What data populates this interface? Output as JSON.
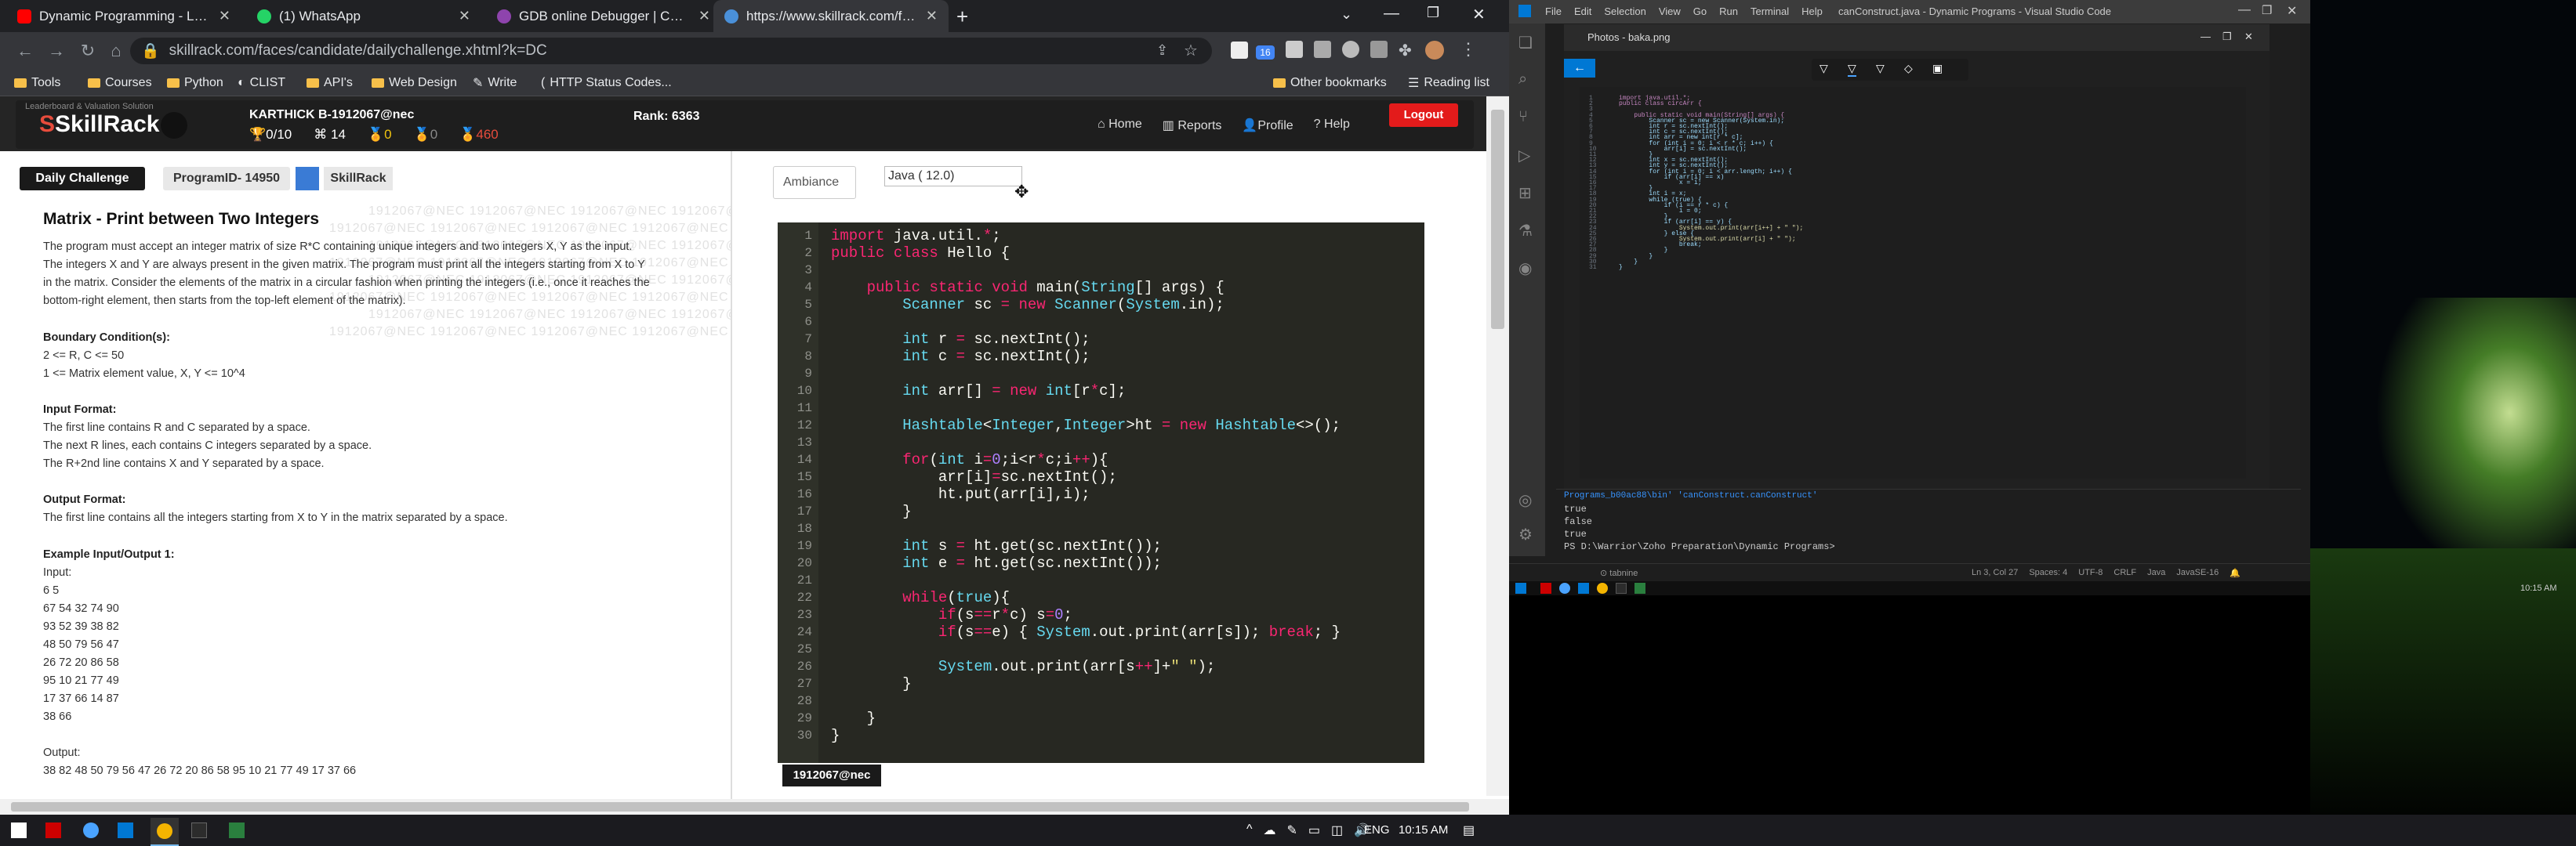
{
  "chrome": {
    "tabs": [
      {
        "title": "Dynamic Programming - Learn t",
        "icon": "youtube-icon",
        "color": "#ff0000"
      },
      {
        "title": "(1) WhatsApp",
        "icon": "whatsapp-icon",
        "color": "#25d366"
      },
      {
        "title": "GDB online Debugger | Compiler",
        "icon": "gdb-icon",
        "color": "#8e44ad"
      },
      {
        "title": "https://www.skillrack.com/faces/",
        "icon": "skillrack-icon",
        "color": "#4a90d9"
      }
    ],
    "url": "skillrack.com/faces/candidate/dailychallenge.xhtml?k=DC",
    "extension_badge": "16",
    "bookmarks": [
      "Tools",
      "Courses",
      "Python",
      "CLIST",
      "API's",
      "Web Design",
      "Write",
      "HTTP Status Codes...",
      "Other bookmarks",
      "Reading list"
    ]
  },
  "skillrack": {
    "logo": "SkillRack",
    "watermark_top": "Leaderboard & Valuation Solution",
    "user": "KARTHICK B-1912067@nec",
    "stats": [
      "0/10",
      "14",
      "0",
      "0",
      "460"
    ],
    "rank": "Rank: 6363",
    "nav": [
      "Home",
      "Reports",
      "Profile",
      "Help"
    ],
    "logout": "Logout",
    "badges": [
      "Daily Challenge",
      "ProgramID- 14950",
      "SkillRack"
    ],
    "watermark": "1912067@NEC",
    "problem": {
      "title": "Matrix - Print between Two Integers",
      "desc": [
        "The program must accept an integer matrix of size R*C containing unique integers and two integers X, Y as the input.",
        "The integers X and Y are always present in the given matrix. The program must print all the integers starting from X to Y",
        "in the matrix. Consider the elements of the matrix in a circular fashion when printing the integers (i.e., once it reaches the",
        "bottom-right element, then starts from the top-left element of the matrix)."
      ],
      "boundary_title": "Boundary Condition(s):",
      "boundary": [
        "2 <= R, C <= 50",
        "1 <= Matrix element value, X, Y <= 10^4"
      ],
      "input_title": "Input Format:",
      "input": [
        "The first line contains R and C separated by a space.",
        "The next R lines, each contains C integers separated by a space.",
        "The R+2nd line contains X and Y separated by a space."
      ],
      "output_title": "Output Format:",
      "output": [
        "The first line contains all the integers starting from X to Y in the matrix separated by a space."
      ],
      "example_title": "Example Input/Output 1:",
      "input_label": "Input:",
      "example_input": [
        "6 5",
        "67 54 32 74 90",
        "93 52 39 38 82",
        "48 50 79 56 47",
        "26 72 20 86 58",
        "95 10 21 77 49",
        "17 37 66 14 87",
        "38 66"
      ],
      "output_label": "Output:",
      "example_output": "38 82 48 50 79 56 47 26 72 20 86 58 95 10 21 77 49 17 37 66"
    },
    "editor": {
      "theme": "Ambiance",
      "language": "Java ( 12.0)",
      "footer_badge": "1912067@nec",
      "lines": [
        "import java.util.*;",
        "public class Hello {",
        "",
        "    public static void main(String[] args) {",
        "        Scanner sc = new Scanner(System.in);",
        "",
        "        int r = sc.nextInt();",
        "        int c = sc.nextInt();",
        "",
        "        int arr[] = new int[r*c];",
        "",
        "        Hashtable<Integer,Integer>ht = new Hashtable<>();",
        "",
        "        for(int i=0;i<r*c;i++){",
        "            arr[i]=sc.nextInt();",
        "            ht.put(arr[i],i);",
        "        }",
        "",
        "        int s = ht.get(sc.nextInt());",
        "        int e = ht.get(sc.nextInt());",
        "",
        "        while(true){",
        "            if(s==r*c) s=0;",
        "            if(s==e) { System.out.print(arr[s]); break; }",
        "",
        "            System.out.print(arr[s++]+\" \");",
        "        }",
        "",
        "    }",
        "}"
      ]
    }
  },
  "vscode": {
    "menu": [
      "File",
      "Edit",
      "Selection",
      "View",
      "Go",
      "Run",
      "Terminal",
      "Help"
    ],
    "title": "canConstruct.java - Dynamic Programs - Visual Studio Code",
    "photos_title": "Photos - baka.png",
    "code": [
      "import java.util.*;",
      "public class circArr {",
      "",
      "    public static void main(String[] args) {",
      "        Scanner sc = new Scanner(System.in);",
      "        int r = sc.nextInt();",
      "        int c = sc.nextInt();",
      "        int arr = new int[r * c];",
      "        for (int i = 0; i < r * c; i++) {",
      "            arr[i] = sc.nextInt();",
      "        }",
      "        int x = sc.nextInt();",
      "        int y = sc.nextInt();",
      "        for (int i = 0; i < arr.length; i++) {",
      "            if (arr[i] == x)",
      "                x = i;",
      "        }",
      "        int i = x;",
      "        while (true) {",
      "            if (i == r * c) {",
      "                i = 0;",
      "            }",
      "            if (arr[i] == y) {",
      "                System.out.print(arr[i++] + \" \");",
      "            } else {",
      "                System.out.print(arr[i] + \" \");",
      "                break;",
      "            }",
      "        }",
      "    }",
      "}"
    ],
    "terminal": [
      "Programs_b00ac88\\bin' 'canConstruct.canConstruct'",
      "true",
      "false",
      "true",
      "PS D:\\Warrior\\Zoho Preparation\\Dynamic Programs> "
    ],
    "status": {
      "cursor": "Ln 3, Col 27",
      "spaces": "Spaces: 4",
      "encoding": "UTF-8",
      "eol": "CRLF",
      "lang": "Java",
      "java": "JavaSE-16",
      "tabnine": "tabnine"
    }
  },
  "taskbar": {
    "time": "10:15 AM",
    "lang": "ENG",
    "desk_time": "10:15 AM"
  }
}
